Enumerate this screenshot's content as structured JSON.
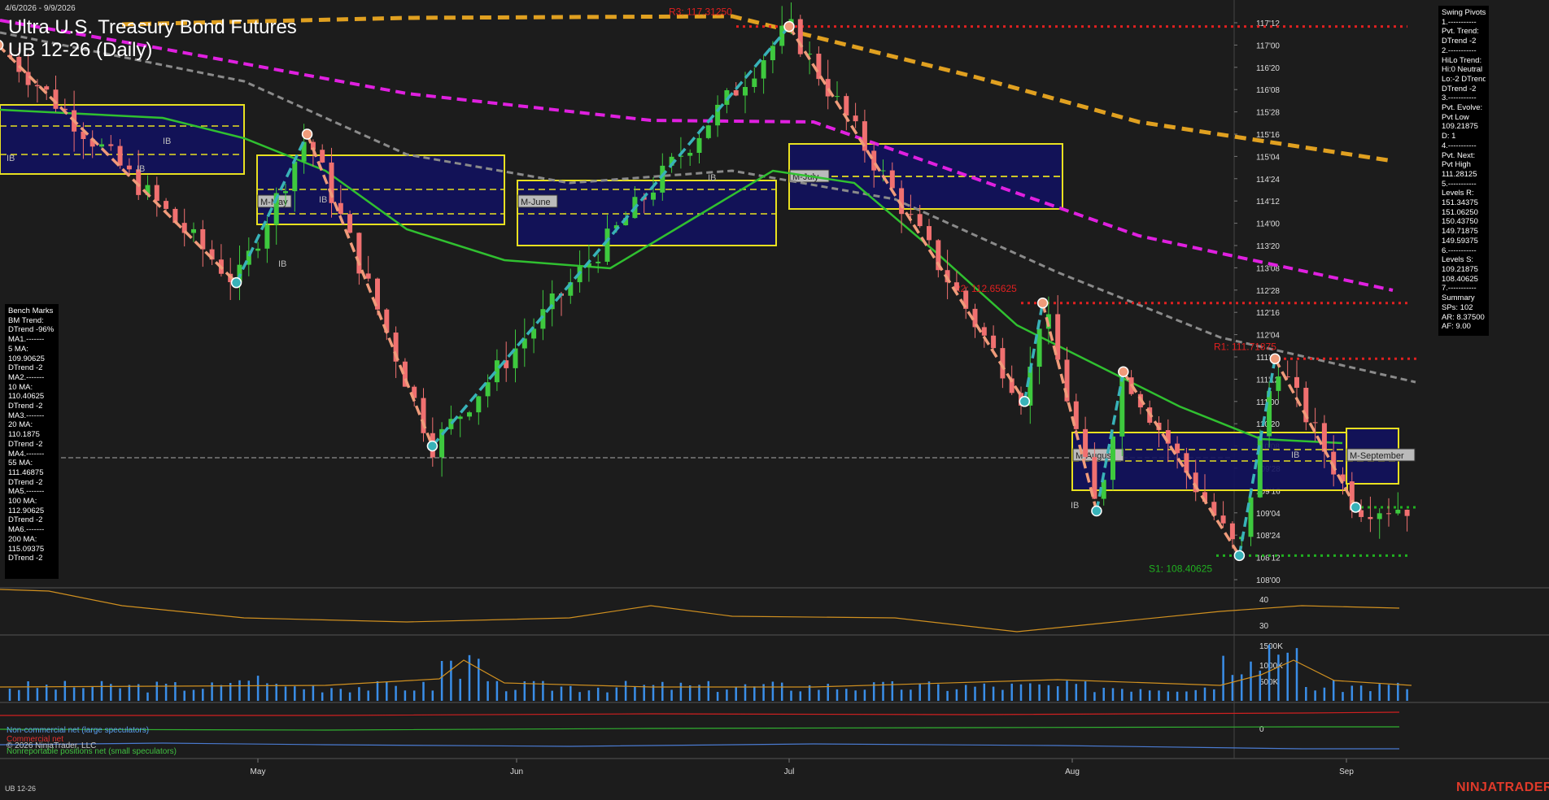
{
  "header": {
    "date_range": "4/6/2026 - 9/9/2026",
    "title_line1": "Ultra U.S. Treasury Bond Futures",
    "title_line2": "UB 12-26 (Daily)"
  },
  "footer": {
    "instrument": "UB 12-26",
    "brand": "NINJATRADER",
    "copyright": "© 2026 NinjaTrader, LLC"
  },
  "colors": {
    "background": "#1c1c1c",
    "bull_candle": "#3ec93e",
    "bear_candle": "#f07070",
    "swing_up": "#38b2b8",
    "swing_down": "#f09b7a",
    "ma_orange": "#e0a020",
    "ma_magenta": "#e020e0",
    "ma_gray": "#8a8a8a",
    "ma_green": "#30c030",
    "resistance": "#e02020",
    "support": "#20b020",
    "box_fill": "#12125e",
    "box_border": "#e8e020"
  },
  "bench_marks": [
    "Bench Marks",
    "BM Trend:",
    "DTrend -96%",
    "MA1.-------",
    "5 MA:",
    "109.90625",
    "DTrend -2",
    "MA2.-------",
    "10 MA:",
    "110.40625",
    "DTrend -2",
    "MA3.-------",
    "20 MA:",
    "110.1875",
    "DTrend -2",
    "MA4.-------",
    "55 MA:",
    "111.46875",
    "DTrend -2",
    "MA5.-------",
    "100 MA:",
    "112.90625",
    "DTrend -2",
    "MA6.-------",
    "200 MA:",
    "115.09375",
    "DTrend -2"
  ],
  "swing_pivots": [
    "Swing Pivots",
    "1.-----------",
    "Pvt. Trend:",
    "DTrend -2",
    "2.-----------",
    "HiLo Trend:",
    "Hi:0 Neutral",
    "Lo:-2 DTrend",
    "DTrend -2",
    "3.-----------",
    "Pvt. Evolve:",
    "Pvt Low",
    "109.21875",
    "D: 1",
    "4.-----------",
    "Pvt. Next:",
    "Pvt High",
    "111.28125",
    "5.-----------",
    "Levels R:",
    "151.34375",
    "151.06250",
    "150.43750",
    "149.71875",
    "149.59375",
    "6.-----------",
    "Levels S:",
    "109.21875",
    "108.40625",
    "7.-----------",
    "Summary",
    "SPs: 102",
    "AR: 8.37500",
    "AF: 9.00"
  ],
  "levels": {
    "r3": "R3: 117.31250",
    "r2": "R2: 112.65625",
    "r1": "R1: 111.71875",
    "s1": "S1: 108.40625"
  },
  "ib_label": "IB",
  "month_boxes": [
    "M-May",
    "M-June",
    "M-July",
    "M-August",
    "M-September"
  ],
  "legend": {
    "noncommercial": "Non-commercial net (large speculators)",
    "commercial": "Commercial net",
    "nonreportable": "Nonreportable positions net (small speculators)"
  },
  "chart_data": {
    "type": "candlestick",
    "price_axis_labels": [
      "117'12",
      "117'00",
      "116'20",
      "116'08",
      "115'28",
      "115'16",
      "115'04",
      "114'24",
      "114'12",
      "114'00",
      "113'20",
      "113'08",
      "112'28",
      "112'16",
      "112'04",
      "111'24",
      "111'12",
      "111'00",
      "110'20",
      "110'08",
      "109'28",
      "109'16",
      "109'04",
      "108'24",
      "108'12",
      "108'00"
    ],
    "price_range": [
      108.0,
      117.375
    ],
    "x_labels": [
      "May",
      "Jun",
      "Jul",
      "Aug",
      "Sep"
    ],
    "indicator_axis_labels": [
      "40",
      "30"
    ],
    "volume_axis_labels": [
      "1500K",
      "1000K",
      "500K"
    ],
    "cot_axis_labels": [
      "0"
    ],
    "moving_averages": [
      {
        "name": "5 MA",
        "value": 109.90625
      },
      {
        "name": "10 MA",
        "value": 110.40625
      },
      {
        "name": "20 MA",
        "value": 110.1875
      },
      {
        "name": "55 MA",
        "value": 111.46875
      },
      {
        "name": "100 MA",
        "value": 112.90625
      },
      {
        "name": "200 MA",
        "value": 115.09375
      }
    ],
    "resistance_levels": [
      117.3125,
      112.65625,
      111.71875
    ],
    "support_levels": [
      108.40625,
      109.21875
    ],
    "swing_points": [
      {
        "x": "Apr 6",
        "y": 117.0
      },
      {
        "x": "Apr 29",
        "y": 113.0
      },
      {
        "x": "May 7",
        "y": 115.5
      },
      {
        "x": "May 22",
        "y": 110.25
      },
      {
        "x": "Jul 1",
        "y": 117.3125
      },
      {
        "x": "Jul 27",
        "y": 111.0
      },
      {
        "x": "Jul 29",
        "y": 112.65625
      },
      {
        "x": "Aug 4",
        "y": 109.15625
      },
      {
        "x": "Aug 7",
        "y": 111.5
      },
      {
        "x": "Aug 20",
        "y": 108.40625
      },
      {
        "x": "Aug 24",
        "y": 111.71875
      },
      {
        "x": "Sep 2",
        "y": 109.21875
      }
    ]
  }
}
